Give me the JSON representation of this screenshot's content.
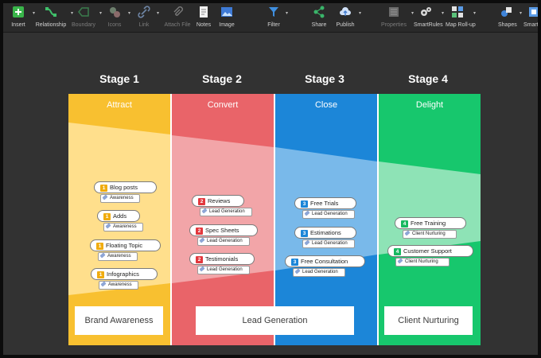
{
  "toolbar": {
    "insert": "Insert",
    "relationship": "Relationship",
    "boundary": "Boundary",
    "icons": "Icons",
    "link": "Link",
    "attach_file": "Attach File",
    "notes": "Notes",
    "image": "Image",
    "filter": "Filter",
    "share": "Share",
    "publish": "Publish",
    "properties": "Properties",
    "smartrules": "SmartRules",
    "map_rollup": "Map Roll-up",
    "shapes": "Shapes",
    "smart": "Smart S"
  },
  "stages": [
    {
      "header": "Stage 1",
      "title": "Attract",
      "color": "#f8c030"
    },
    {
      "header": "Stage 2",
      "title": "Convert",
      "color": "#e96469"
    },
    {
      "header": "Stage 3",
      "title": "Close",
      "color": "#1c86d8"
    },
    {
      "header": "Stage 4",
      "title": "Delight",
      "color": "#17c76d"
    }
  ],
  "topics": [
    {
      "num": "1",
      "text": "Blog posts",
      "tag": "Awareness",
      "color": "#f0ac10"
    },
    {
      "num": "1",
      "text": "Adds",
      "tag": "Awareness",
      "color": "#f0ac10"
    },
    {
      "num": "1",
      "text": "Floating Topic",
      "tag": "Awareness",
      "color": "#f0ac10"
    },
    {
      "num": "1",
      "text": "Infographics",
      "tag": "Awareness",
      "color": "#f0ac10"
    },
    {
      "num": "2",
      "text": "Reviews",
      "tag": "Lead Generation",
      "color": "#e2383d"
    },
    {
      "num": "2",
      "text": "Spec Sheets",
      "tag": "Lead Generation",
      "color": "#e2383d"
    },
    {
      "num": "2",
      "text": "Testimonials",
      "tag": "Lead Generation",
      "color": "#e2383d"
    },
    {
      "num": "3",
      "text": "Free Trials",
      "tag": "Lead Generation",
      "color": "#1c86d8"
    },
    {
      "num": "3",
      "text": "Estimations",
      "tag": "Lead Generation",
      "color": "#1c86d8"
    },
    {
      "num": "3",
      "text": "Free Consultation",
      "tag": "Lead Generation",
      "color": "#1c86d8"
    },
    {
      "num": "4",
      "text": "Free Training",
      "tag": "Client Nurturing",
      "color": "#17b860"
    },
    {
      "num": "4",
      "text": "Customer Support",
      "tag": "Client Nurturing",
      "color": "#17b860"
    }
  ],
  "outcomes": {
    "brand_awareness": "Brand Awareness",
    "lead_generation": "Lead Generation",
    "client_nurturing": "Client Nurturing"
  }
}
